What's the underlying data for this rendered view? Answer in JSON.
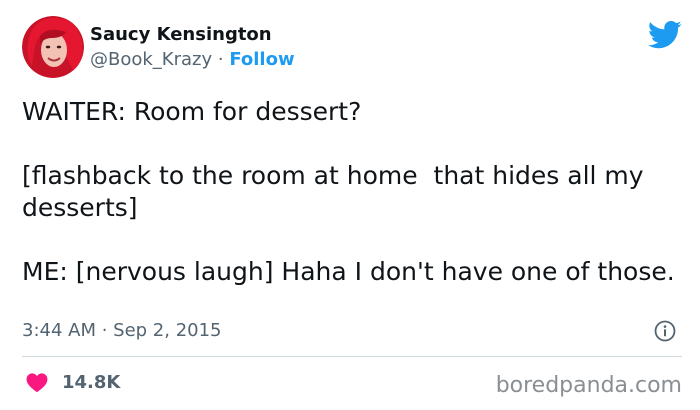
{
  "author": {
    "display_name": "Saucy Kensington",
    "handle": "@Book_Krazy",
    "separator": " · ",
    "follow_label": "Follow"
  },
  "tweet": {
    "paragraphs": [
      "WAITER: Room for dessert?",
      "[flashback to the room at home  that hides all my desserts]",
      "ME: [nervous laugh] Haha I don't have one of those."
    ],
    "timestamp": "3:44 AM · Sep 2, 2015"
  },
  "engagement": {
    "likes": "14.8K"
  },
  "watermark": "boredpanda.com",
  "icons": {
    "brand": "twitter-bird-icon",
    "info": "info-icon",
    "like": "heart-icon"
  },
  "colors": {
    "accent": "#1d9bf0",
    "heart": "#f91880",
    "secondary_text": "#536471",
    "divider": "#cfd9de"
  }
}
